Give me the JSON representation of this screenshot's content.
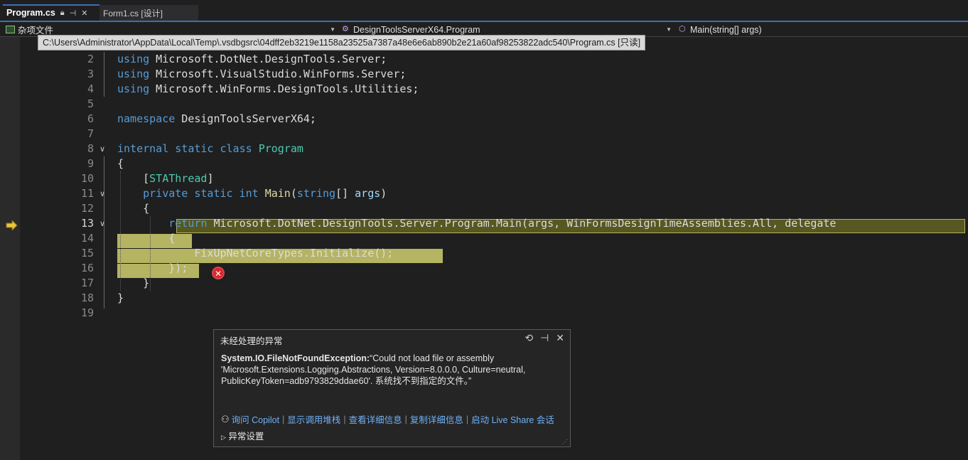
{
  "tabs": [
    {
      "label": "Program.cs",
      "pin": "⊣",
      "lock": "🔒",
      "close": "✕"
    },
    {
      "label": "Form1.cs [设计]"
    }
  ],
  "navbar": {
    "project": "杂项文件",
    "type": "DesignToolsServerX64.Program",
    "member": "Main(string[] args)"
  },
  "path_tooltip": "C:\\Users\\Administrator\\AppData\\Local\\Temp\\.vsdbgsrc\\04dff2eb3219e1158a23525a7387a48e6e6ab890b2e21a60af98253822adc540\\Program.cs [只读]",
  "code": {
    "lines": [
      {
        "n": "2",
        "parts": [
          [
            "kw",
            "using"
          ],
          [
            "t",
            " Microsoft.DotNet.DesignTools.Server;"
          ]
        ]
      },
      {
        "n": "3",
        "parts": [
          [
            "kw",
            "using"
          ],
          [
            "t",
            " Microsoft.VisualStudio.WinForms.Server;"
          ]
        ]
      },
      {
        "n": "4",
        "parts": [
          [
            "kw",
            "using"
          ],
          [
            "t",
            " Microsoft.WinForms.DesignTools.Utilities;"
          ]
        ]
      },
      {
        "n": "5",
        "parts": []
      },
      {
        "n": "6",
        "parts": [
          [
            "kw",
            "namespace"
          ],
          [
            "t",
            " DesignToolsServerX64;"
          ]
        ]
      },
      {
        "n": "7",
        "parts": []
      },
      {
        "n": "8",
        "parts": [
          [
            "kw",
            "internal static class"
          ],
          [
            "t",
            " "
          ],
          [
            "ty",
            "Program"
          ]
        ]
      },
      {
        "n": "9",
        "parts": [
          [
            "t",
            "{"
          ]
        ]
      },
      {
        "n": "10",
        "parts": [
          [
            "t",
            "    ["
          ],
          [
            "ty",
            "STAThread"
          ],
          [
            "t",
            "]"
          ]
        ]
      },
      {
        "n": "11",
        "parts": [
          [
            "t",
            "    "
          ],
          [
            "kw",
            "private static int"
          ],
          [
            "t",
            " "
          ],
          [
            "fn",
            "Main"
          ],
          [
            "t",
            "("
          ],
          [
            "kw",
            "string"
          ],
          [
            "t",
            "[] "
          ],
          [
            "pr",
            "args"
          ],
          [
            "t",
            ")"
          ]
        ]
      },
      {
        "n": "12",
        "parts": [
          [
            "t",
            "    {"
          ]
        ]
      },
      {
        "n": "13",
        "parts": [
          [
            "t",
            "        "
          ],
          [
            "kw",
            "return"
          ],
          [
            "t",
            " Microsoft.DotNet.DesignTools.Server.Program.Main(args, WinFormsDesignTimeAssemblies.All, delegate"
          ]
        ]
      },
      {
        "n": "14",
        "parts": [
          [
            "t",
            "        {"
          ]
        ]
      },
      {
        "n": "15",
        "parts": [
          [
            "t",
            "            FixUpNetCoreTypes.Initialize();"
          ]
        ]
      },
      {
        "n": "16",
        "parts": [
          [
            "t",
            "        });"
          ]
        ]
      },
      {
        "n": "17",
        "parts": [
          [
            "t",
            "    }"
          ]
        ]
      },
      {
        "n": "18",
        "parts": [
          [
            "t",
            "}"
          ]
        ]
      },
      {
        "n": "19",
        "parts": []
      }
    ],
    "current_line": "13"
  },
  "exception": {
    "title": "未经处理的异常",
    "type": "System.IO.FileNotFoundException:",
    "message_l1": "“Could not load file or assembly",
    "message_l2": "'Microsoft.Extensions.Logging.Abstractions, Version=8.0.0.0, Culture=neutral,",
    "message_l3": "PublicKeyToken=adb9793829ddae60'. 系统找不到指定的文件。”",
    "links": [
      "询问 Copilot",
      "显示调用堆栈",
      "查看详细信息",
      "复制详细信息",
      "启动 Live Share 会话"
    ],
    "settings": "异常设置"
  },
  "colors": {
    "keyword": "#569cd6",
    "type": "#4ec9b0",
    "highlight": "#c4c46a",
    "link": "#6fb1f5"
  }
}
